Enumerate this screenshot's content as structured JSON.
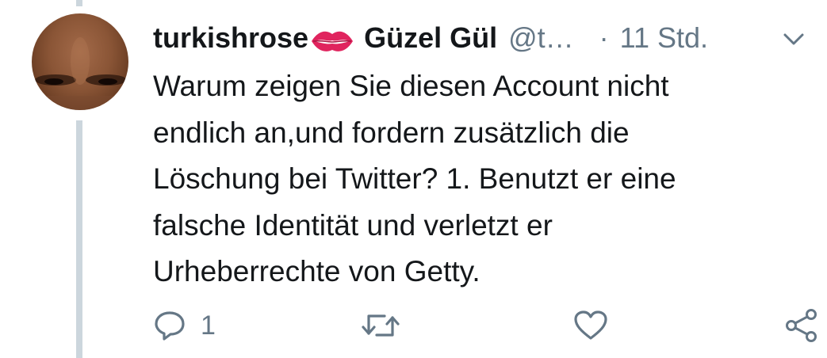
{
  "tweet": {
    "display_name": "turkishrose",
    "emoji": "lips-emoji",
    "real_name": "Güzel Gül",
    "handle": "@t…",
    "separator": "·",
    "timestamp": "11 Std.",
    "text": "Warum zeigen Sie diesen Account nicht\nendlich an,und fordern zusätzlich die\nLöschung bei Twitter? 1. Benutzt er eine\nfalsche Identität und verletzt er\nUrheberrechte von Getty."
  },
  "actions": {
    "reply": {
      "icon": "reply-icon",
      "count": "1"
    },
    "retweet": {
      "icon": "retweet-icon"
    },
    "like": {
      "icon": "heart-icon"
    },
    "share": {
      "icon": "share-icon"
    }
  },
  "colors": {
    "text": "#14171a",
    "secondary": "#657786",
    "thread_line": "#ccd6dd",
    "emoji_lips": "#e0245e"
  }
}
